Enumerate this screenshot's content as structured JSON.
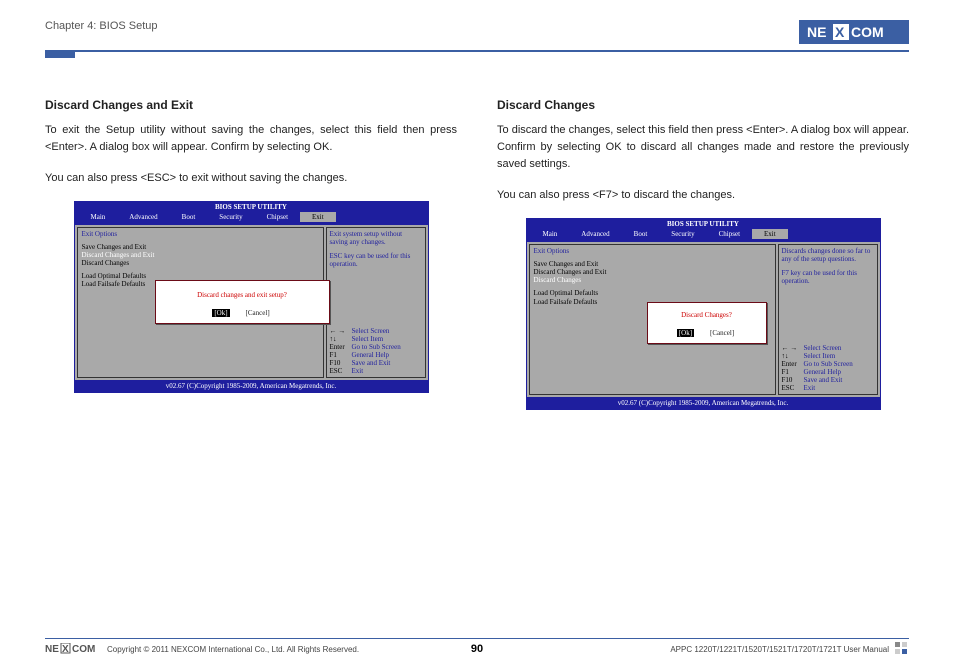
{
  "header": {
    "chapter": "Chapter 4: BIOS Setup",
    "logo_text": "NEXCOM"
  },
  "left": {
    "heading": "Discard Changes and Exit",
    "p1": "To exit the Setup utility without saving the changes, select this field then press <Enter>. A dialog box will appear. Confirm by selecting OK.",
    "p2": "You can also press <ESC> to exit without saving the changes."
  },
  "right": {
    "heading": "Discard Changes",
    "p1": "To discard the changes, select this field then press <Enter>. A dialog box will appear. Confirm by selecting OK to discard all changes made and restore the previously saved settings.",
    "p2": "You can also press <F7> to discard the changes."
  },
  "bios_common": {
    "title": "BIOS SETUP UTILITY",
    "tabs": [
      "Main",
      "Advanced",
      "Boot",
      "Security",
      "Chipset",
      "Exit"
    ],
    "foot": "v02.67 (C)Copyright 1985-2009, American Megatrends, Inc.",
    "exit_options_label": "Exit Options",
    "items1": "Save Changes and Exit",
    "items2": "Discard Changes and Exit",
    "items3": "Discard Changes",
    "items4": "Load Optimal Defaults",
    "items5": "Load Failsafe Defaults",
    "keys": {
      "k1": "← →",
      "d1": "Select Screen",
      "k2": "↑↓",
      "d2": "Select Item",
      "k3": "Enter",
      "d3": "Go to Sub Screen",
      "k4": "F1",
      "d4": "General Help",
      "k5": "F10",
      "d5": "Save and Exit",
      "k6": "ESC",
      "d6": "Exit"
    }
  },
  "bios_left": {
    "help1": "Exit system setup without saving any changes.",
    "help2": "ESC key can be used for this operation.",
    "dialog_q": "Discard changes and exit setup?",
    "ok": "[Ok]",
    "cancel": "[Cancel]"
  },
  "bios_right": {
    "help1": "Discards changes done so far to any of the setup questions.",
    "help2": "F7 key can be used for this operation.",
    "dialog_q": "Discard Changes?",
    "ok": "[Ok]",
    "cancel": "[Cancel]"
  },
  "footer": {
    "copyright": "Copyright © 2011 NEXCOM International Co., Ltd. All Rights Reserved.",
    "page": "90",
    "manual": "APPC 1220T/1221T/1520T/1521T/1720T/1721T User Manual",
    "logo_text": "NEXCOM"
  }
}
